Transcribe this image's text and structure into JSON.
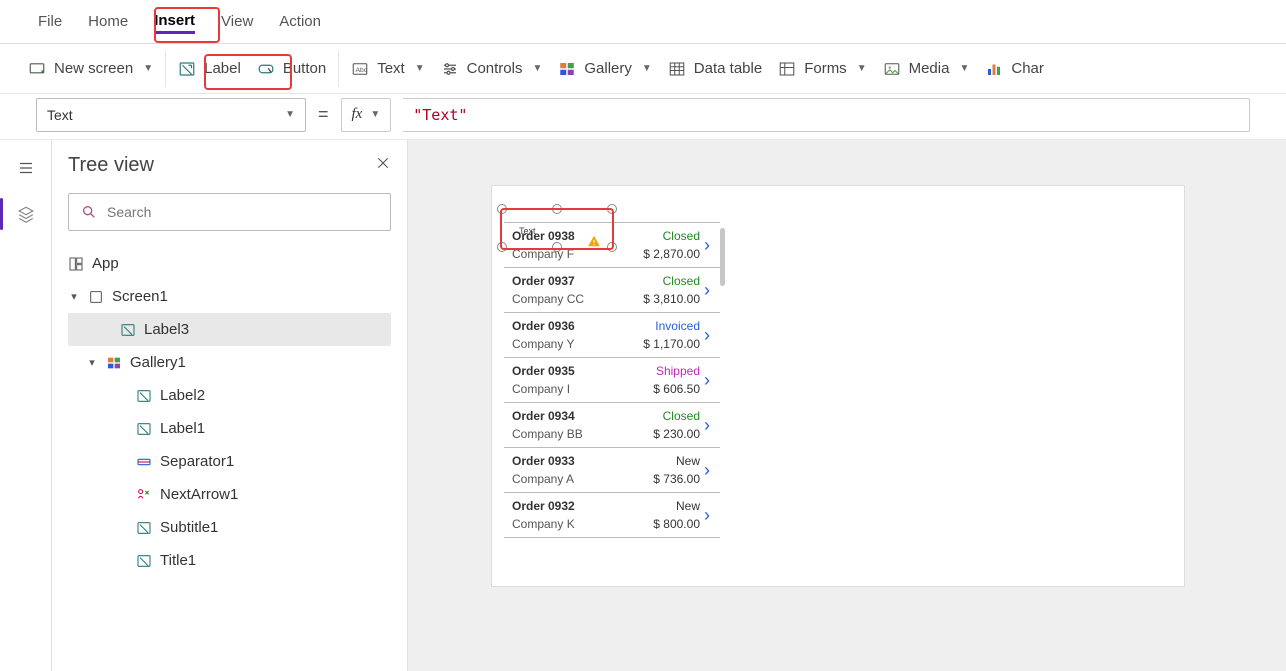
{
  "menu": {
    "file": "File",
    "home": "Home",
    "insert": "Insert",
    "view": "View",
    "action": "Action"
  },
  "ribbon": {
    "new_screen": "New screen",
    "label": "Label",
    "button": "Button",
    "text": "Text",
    "controls": "Controls",
    "gallery": "Gallery",
    "data_table": "Data table",
    "forms": "Forms",
    "media": "Media",
    "charts": "Char"
  },
  "formula": {
    "property": "Text",
    "value": "\"Text\""
  },
  "tree": {
    "title": "Tree view",
    "search_placeholder": "Search",
    "app": "App",
    "screen1": "Screen1",
    "label3": "Label3",
    "gallery1": "Gallery1",
    "label2": "Label2",
    "label1": "Label1",
    "separator1": "Separator1",
    "nextarrow1": "NextArrow1",
    "subtitle1": "Subtitle1",
    "title1": "Title1"
  },
  "label_overlay_text": "Text",
  "gallery_items": [
    {
      "order": "Order 0938",
      "company": "Company F",
      "status": "Closed",
      "amount": "$ 2,870.00"
    },
    {
      "order": "Order 0937",
      "company": "Company CC",
      "status": "Closed",
      "amount": "$ 3,810.00"
    },
    {
      "order": "Order 0936",
      "company": "Company Y",
      "status": "Invoiced",
      "amount": "$ 1,170.00"
    },
    {
      "order": "Order 0935",
      "company": "Company I",
      "status": "Shipped",
      "amount": "$ 606.50"
    },
    {
      "order": "Order 0934",
      "company": "Company BB",
      "status": "Closed",
      "amount": "$ 230.00"
    },
    {
      "order": "Order 0933",
      "company": "Company A",
      "status": "New",
      "amount": "$ 736.00"
    },
    {
      "order": "Order 0932",
      "company": "Company K",
      "status": "New",
      "amount": "$ 800.00"
    }
  ]
}
